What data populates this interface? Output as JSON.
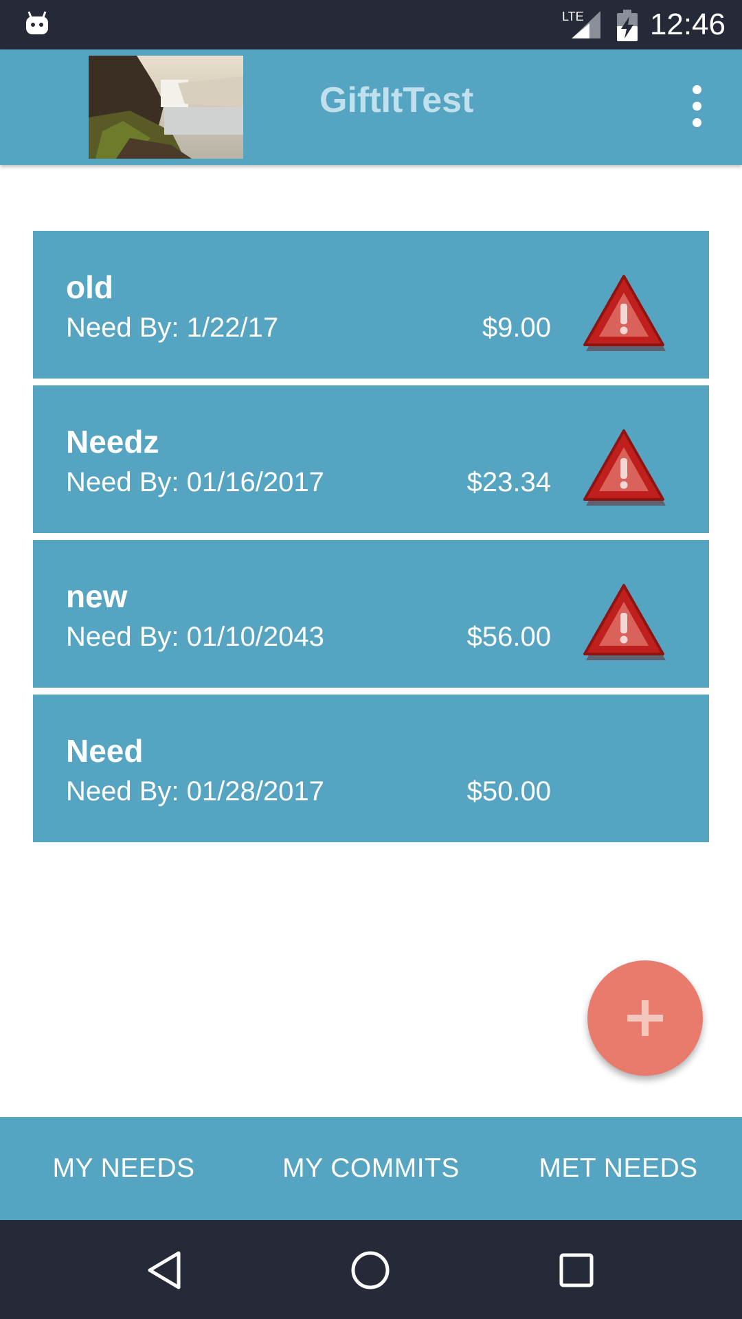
{
  "status_bar": {
    "time": "12:46",
    "network_label": "LTE",
    "icons": [
      "android-icon",
      "lte-signal-icon",
      "battery-charging-icon"
    ]
  },
  "app_bar": {
    "title": "GiftItTest",
    "header_image": "waterfall-landscape-image",
    "menu_icon": "more-vert-icon"
  },
  "needs": [
    {
      "title": "old",
      "need_by": "Need By: 1/22/17",
      "amount": "$9.00",
      "warning": true
    },
    {
      "title": "Needz",
      "need_by": "Need By: 01/16/2017",
      "amount": "$23.34",
      "warning": true
    },
    {
      "title": "new",
      "need_by": "Need By: 01/10/2043",
      "amount": "$56.00",
      "warning": true
    },
    {
      "title": "Need",
      "need_by": "Need By: 01/28/2017",
      "amount": "$50.00",
      "warning": false
    }
  ],
  "fab": {
    "icon": "plus-icon"
  },
  "tabs": [
    {
      "label": "MY NEEDS"
    },
    {
      "label": "MY COMMITS"
    },
    {
      "label": "MET NEEDS"
    }
  ],
  "nav_bar": {
    "icons": [
      "back-icon",
      "home-icon",
      "recents-icon"
    ]
  },
  "colors": {
    "primary": "#55a4c1",
    "status_bar": "#262a38",
    "fab": "#e87b6c",
    "warning": "#c0201d",
    "title_text": "#bfe0ec"
  }
}
